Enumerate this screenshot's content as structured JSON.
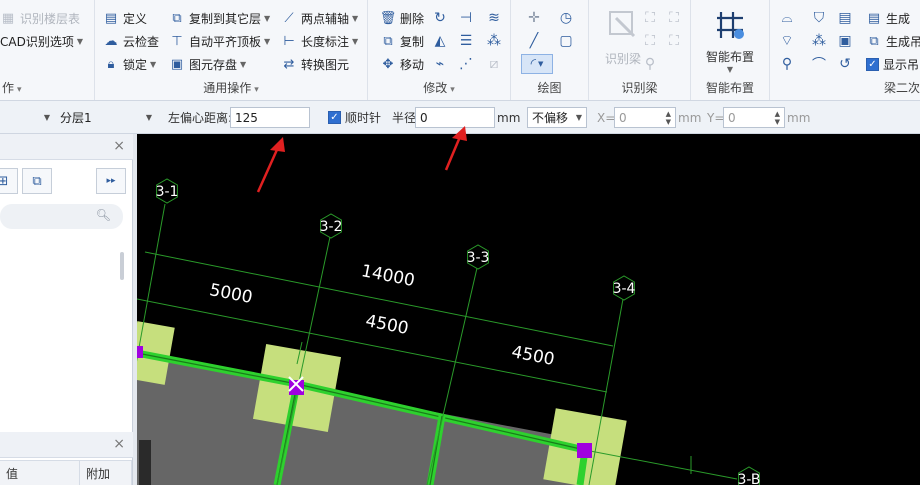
{
  "ribbon": {
    "group_layer": {
      "items": [
        {
          "label": "识别楼层表",
          "icon": "table-icon",
          "disabled": true
        },
        {
          "label": "CAD识别选项",
          "icon": "",
          "caret": true
        }
      ],
      "title": "作"
    },
    "group_common": {
      "title": "通用操作",
      "items": [
        {
          "label": "定义",
          "icon": "define-icon"
        },
        {
          "label": "云检查",
          "icon": "cloud-check-icon"
        },
        {
          "label": "锁定",
          "icon": "lock-icon",
          "caret": true
        },
        {
          "label": "复制到其它层",
          "icon": "copy-layer-icon",
          "caret": true
        },
        {
          "label": "自动平齐顶板",
          "icon": "align-top-icon",
          "caret": true
        },
        {
          "label": "图元存盘",
          "icon": "save-element-icon",
          "caret": true
        },
        {
          "label": "两点辅轴",
          "icon": "aux-axis-icon",
          "caret": true
        },
        {
          "label": "长度标注",
          "icon": "dimension-icon",
          "caret": true
        },
        {
          "label": "转换图元",
          "icon": "convert-icon"
        }
      ]
    },
    "group_modify": {
      "title": "修改",
      "items": [
        {
          "label": "删除",
          "icon": "delete-icon"
        },
        {
          "label": "复制",
          "icon": "copy-icon"
        },
        {
          "label": "移动",
          "icon": "move-icon"
        }
      ],
      "icons": [
        "rotate-icon",
        "trim-icon",
        "offset-icon",
        "mirror-icon",
        "align-icon",
        "break-icon",
        "extend-icon",
        "merge-icon",
        "split-icon"
      ]
    },
    "group_draw": {
      "title": "绘图",
      "icons": [
        "point-icon",
        "line-icon",
        "arc-icon",
        "circle-icon",
        "rectangle-icon"
      ]
    },
    "group_beam": {
      "title": "识别梁",
      "items": [
        {
          "label": "识别梁",
          "icon": "recognize-beam-icon",
          "disabled": true
        }
      ]
    },
    "group_smart": {
      "title": "智能布置",
      "items": [
        {
          "label": "智能布置",
          "icon": "smart-layout-icon",
          "caret": true
        }
      ]
    },
    "group_beam2": {
      "title": "梁二次",
      "items": [
        {
          "label": "生成",
          "icon": "generate-icon"
        },
        {
          "label": "生成吊",
          "icon": "generate-hanger-icon"
        },
        {
          "label": "显示吊",
          "icon": "checkbox-icon",
          "checked": true
        }
      ]
    }
  },
  "propbar": {
    "layer_select": "",
    "sublayer_select": "分层1",
    "offset_label": "左偏心距离:",
    "offset_value": "125",
    "clockwise_label": "顺时针",
    "clockwise_checked": true,
    "radius_label": "半径",
    "radius_value": "0",
    "radius_unit": "mm",
    "offset_mode": "不偏移",
    "x_label": "X=",
    "x_value": "0",
    "x_unit": "mm",
    "y_label": "Y=",
    "y_value": "0",
    "y_unit": "mm"
  },
  "left_panel": {
    "top_close": "×",
    "bottom_close": "×",
    "col_value": "值",
    "col_extra": "附加"
  },
  "canvas": {
    "axes": [
      {
        "label": "3-1"
      },
      {
        "label": "3-2"
      },
      {
        "label": "3-3"
      },
      {
        "label": "3-4"
      },
      {
        "label": "3-B"
      }
    ],
    "dimensions": [
      {
        "text": "14000"
      },
      {
        "text": "5000"
      },
      {
        "text": "4500"
      },
      {
        "text": "4500"
      }
    ],
    "colors": {
      "background": "#000000",
      "axis": "#2a9a2a",
      "beam": "#2ed12e",
      "column": "#c6df7d",
      "slab": "#666666",
      "marker": "#a000e0",
      "annotation": "#e02020"
    }
  }
}
